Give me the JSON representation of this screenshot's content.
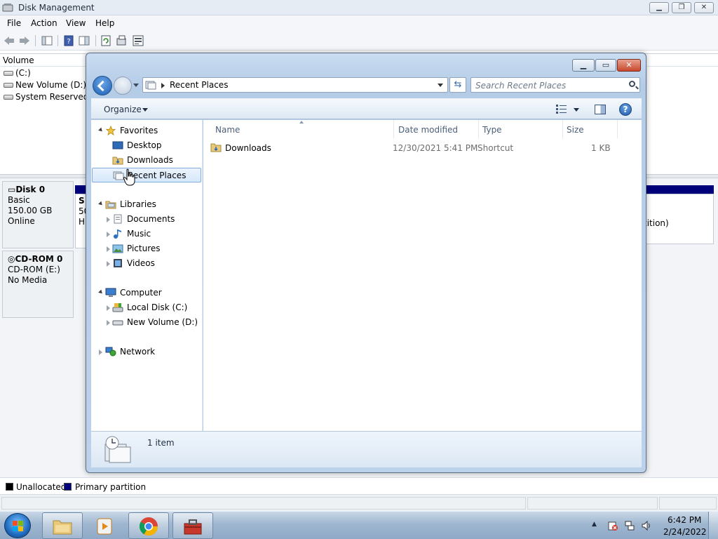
{
  "disk_management": {
    "title": "Disk Management",
    "menu": [
      "File",
      "Action",
      "View",
      "Help"
    ],
    "volume_list": {
      "header": "Volume",
      "rows": [
        "(C:)",
        "New Volume (D:)",
        "System Reserved"
      ]
    },
    "disks": [
      {
        "name": "Disk 0",
        "type": "Basic",
        "size": "150.00 GB",
        "status": "Online"
      },
      {
        "name": "CD-ROM 0",
        "type": "CD-ROM (E:)",
        "size": "",
        "status": "No Media"
      }
    ],
    "partition_fragments": {
      "first_letter": "S",
      "line2": "50",
      "line3": "H",
      "right_text": "tition)"
    },
    "legend": [
      {
        "label": "Unallocated",
        "color": "#000000"
      },
      {
        "label": "Primary partition",
        "color": "#00007a"
      }
    ]
  },
  "explorer": {
    "address": {
      "current": "Recent Places"
    },
    "search": {
      "placeholder": "Search Recent Places"
    },
    "toolbar": {
      "organize": "Organize"
    },
    "nav": {
      "favorites": "Favorites",
      "desktop": "Desktop",
      "downloads": "Downloads",
      "recent_places": "Recent Places",
      "libraries": "Libraries",
      "documents": "Documents",
      "music": "Music",
      "pictures": "Pictures",
      "videos": "Videos",
      "computer": "Computer",
      "local_disk": "Local Disk (C:)",
      "new_volume": "New Volume (D:)",
      "network": "Network"
    },
    "columns": {
      "name": "Name",
      "date": "Date modified",
      "type": "Type",
      "size": "Size"
    },
    "files": [
      {
        "name": "Downloads",
        "date": "12/30/2021 5:41 PM",
        "type": "Shortcut",
        "size": "1 KB"
      }
    ],
    "details": {
      "count": "1 item"
    }
  },
  "taskbar": {
    "time": "6:42 PM",
    "date": "2/24/2022",
    "apps": [
      "windows-explorer",
      "media-player",
      "chrome",
      "toolbox"
    ]
  }
}
